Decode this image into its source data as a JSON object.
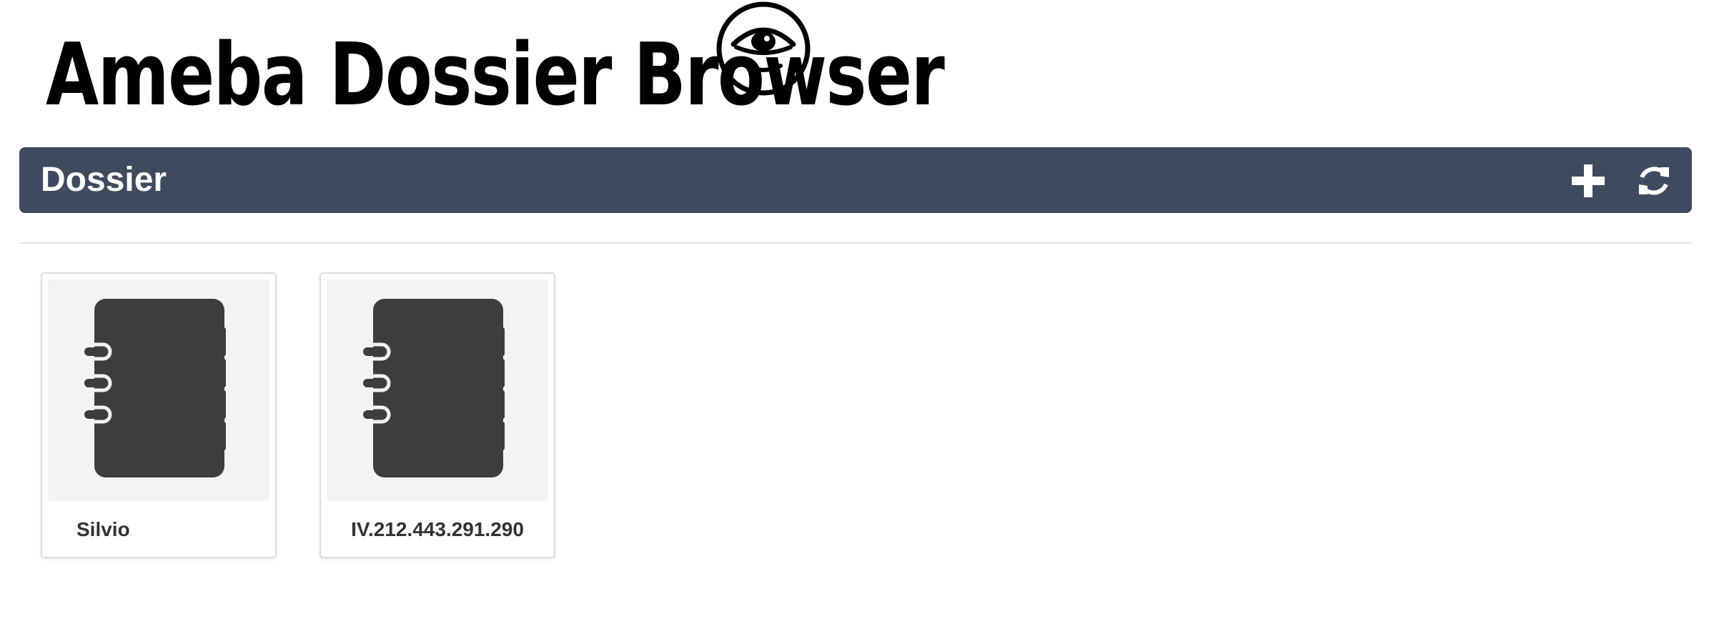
{
  "header": {
    "title": "Ameba Dossier Browser",
    "logo_icon": "eye-icon"
  },
  "panel": {
    "title": "Dossier",
    "add_icon": "plus-icon",
    "refresh_icon": "refresh-icon",
    "background_color": "#3e4a5e"
  },
  "dossiers": [
    {
      "name": "Silvio",
      "icon": "notebook-icon"
    },
    {
      "name": "IV.212.443.291.290",
      "icon": "notebook-icon"
    }
  ]
}
